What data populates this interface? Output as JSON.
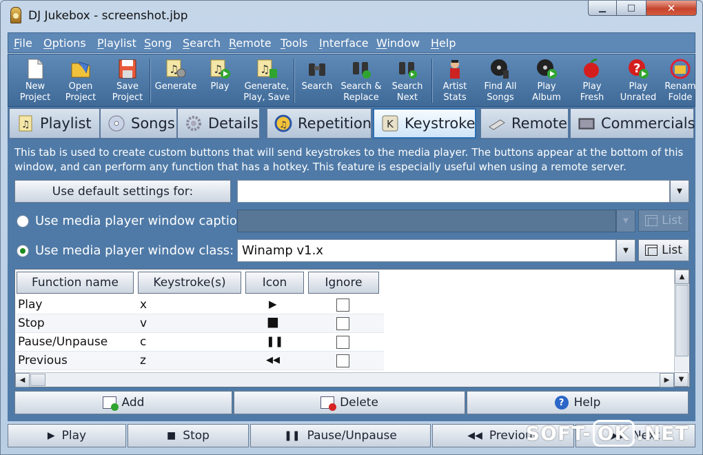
{
  "window": {
    "title": "DJ Jukebox - screenshot.jbp",
    "min": "▁",
    "max": "□",
    "close": "✕"
  },
  "menu": [
    "File",
    "Options",
    "Playlist",
    "Song",
    "Search",
    "Remote",
    "Tools",
    "Interface",
    "Window",
    "Help"
  ],
  "toolbar": [
    {
      "label1": "New",
      "label2": "Project",
      "icon": "new-project-icon"
    },
    {
      "label1": "Open",
      "label2": "Project",
      "icon": "open-project-icon"
    },
    {
      "label1": "Save",
      "label2": "Project",
      "icon": "save-project-icon"
    },
    {
      "label1": "Generate",
      "label2": "",
      "icon": "generate-icon"
    },
    {
      "label1": "Play",
      "label2": "",
      "icon": "play-playlist-icon"
    },
    {
      "label1": "Generate,",
      "label2": "Play, Save",
      "icon": "generate-play-save-icon"
    },
    {
      "label1": "Search",
      "label2": "",
      "icon": "search-binoculars-icon"
    },
    {
      "label1": "Search &",
      "label2": "Replace",
      "icon": "search-replace-icon"
    },
    {
      "label1": "Search",
      "label2": "Next",
      "icon": "search-next-icon"
    },
    {
      "label1": "Artist",
      "label2": "Stats",
      "icon": "artist-stats-icon"
    },
    {
      "label1": "Find All",
      "label2": "Songs",
      "icon": "find-all-songs-icon"
    },
    {
      "label1": "Play",
      "label2": "Album",
      "icon": "play-album-icon"
    },
    {
      "label1": "Play",
      "label2": "Fresh",
      "icon": "play-fresh-icon"
    },
    {
      "label1": "Play",
      "label2": "Unrated",
      "icon": "play-unrated-icon"
    },
    {
      "label1": "Renam",
      "label2": "Folde",
      "icon": "rename-folder-icon"
    }
  ],
  "tabs": [
    "Playlist",
    "Songs",
    "Details",
    "Repetition",
    "Keystroke",
    "Remote",
    "Commercials"
  ],
  "active_tab": "Keystroke",
  "description": "This tab is used to create custom buttons that will send keystrokes to the media player.  The buttons appear at the bottom of this window, and can perform any function that has a hotkey.  This feature is especially useful when using a remote server.",
  "default_settings_label": "Use default settings for:",
  "default_settings_value": "",
  "caption_label": "Use media player window caption:",
  "caption_value": "",
  "class_label": "Use media player window class:",
  "class_value": "Winamp v1.x",
  "list_label": "List",
  "columns": [
    "Function name",
    "Keystroke(s)",
    "Icon",
    "Ignore"
  ],
  "rows": [
    {
      "name": "Play",
      "key": "x",
      "icon": "▶",
      "icon_name": "play-icon",
      "ignore": false
    },
    {
      "name": "Stop",
      "key": "v",
      "icon": "■",
      "icon_name": "stop-icon",
      "ignore": false
    },
    {
      "name": "Pause/Unpause",
      "key": "c",
      "icon": "❚❚",
      "icon_name": "pause-icon",
      "ignore": false
    },
    {
      "name": "Previous",
      "key": "z",
      "icon": "◀◀",
      "icon_name": "previous-icon",
      "ignore": false
    }
  ],
  "actions": {
    "add": "Add",
    "delete": "Delete",
    "help": "Help"
  },
  "player_buttons": [
    {
      "label": "Play",
      "glyph": "▶"
    },
    {
      "label": "Stop",
      "glyph": "■"
    },
    {
      "label": "Pause/Unpause",
      "glyph": "❚❚"
    },
    {
      "label": "Previous",
      "glyph": "◀◀"
    },
    {
      "label": "Next",
      "glyph": "▶▶"
    }
  ],
  "watermark": {
    "part1": "SOFT-",
    "part2": "OK",
    ".net": ".NET"
  }
}
